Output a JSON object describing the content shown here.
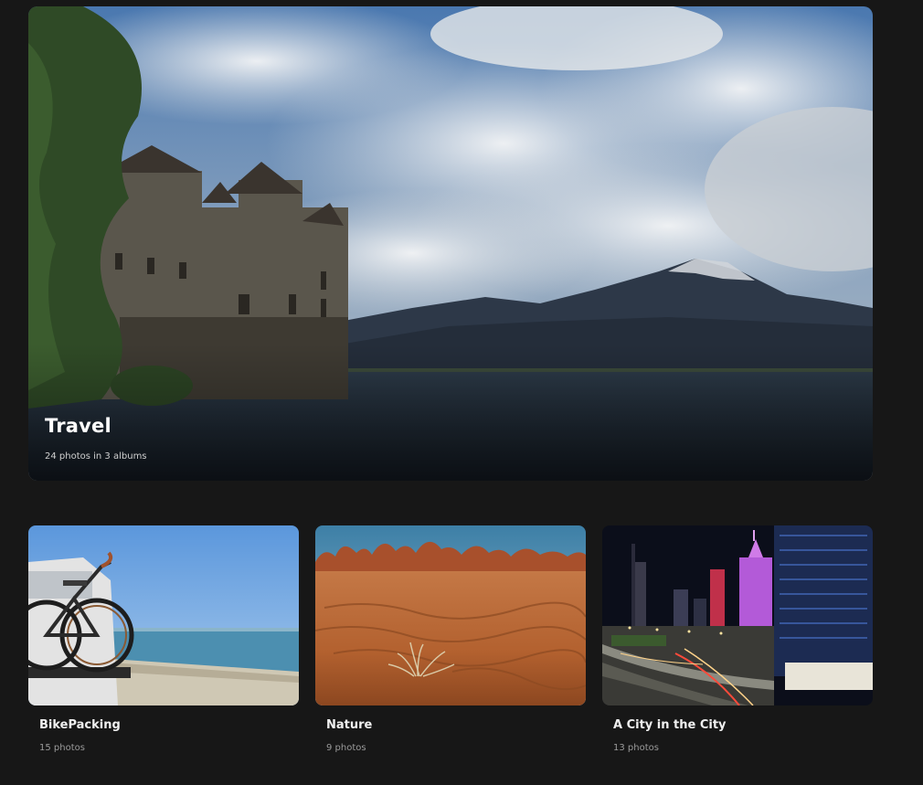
{
  "featured": {
    "title": "Travel",
    "subtitle": "24 photos in 3 albums"
  },
  "albums": [
    {
      "name": "BikePacking",
      "count": "15 photos"
    },
    {
      "name": "Nature",
      "count": "9 photos"
    },
    {
      "name": "A City in the City",
      "count": "13 photos"
    }
  ],
  "colors": {
    "background": "#171717",
    "title_text": "#ffffff",
    "secondary_text": "#9a9a9a"
  }
}
